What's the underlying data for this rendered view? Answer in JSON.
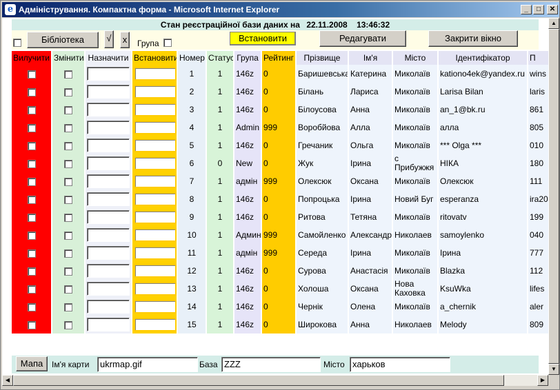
{
  "window": {
    "title": "Адміністрування. Компактна форма - Microsoft Internet Explorer"
  },
  "status": {
    "label": "Стан реєстраційної бази даних на",
    "date": "22.11.2008",
    "time": "13:46:32"
  },
  "toolbar": {
    "library_label": "Бібліотека",
    "check_label": "√",
    "x_label": "x",
    "group_label": "Група",
    "install_label": "Встановити",
    "edit_label": "Редагувати",
    "close_label": "Закрити вікно"
  },
  "table": {
    "headers": {
      "delete": "Вилучити",
      "change": "Змінити",
      "assign": "Назначити",
      "set": "Встановити",
      "number": "Номер",
      "status": "Статус",
      "group": "Група",
      "rating": "Рейтинг",
      "surname": "Прізвище",
      "name": "Ім'я",
      "city": "Місто",
      "id": "Ідентифікатор",
      "extra": "П"
    },
    "rows": [
      {
        "num": "1",
        "status": "1",
        "group": "146z",
        "rating": "0",
        "surname": "Баришевська",
        "name": "Катерина",
        "city": "Миколаїв",
        "id": "kationo4ek@yandex.ru",
        "extra": "wins"
      },
      {
        "num": "2",
        "status": "1",
        "group": "146z",
        "rating": "0",
        "surname": "Білань",
        "name": "Лариса",
        "city": "Миколаїв",
        "id": "Larisa Bilan",
        "extra": "laris"
      },
      {
        "num": "3",
        "status": "1",
        "group": "146z",
        "rating": "0",
        "surname": "Білоусова",
        "name": "Анна",
        "city": "Миколаїв",
        "id": "an_1@bk.ru",
        "extra": "861"
      },
      {
        "num": "4",
        "status": "1",
        "group": "Admin",
        "rating": "999",
        "surname": "Воробйова",
        "name": "Алла",
        "city": "Миколаїв",
        "id": "алла",
        "extra": "805"
      },
      {
        "num": "5",
        "status": "1",
        "group": "146z",
        "rating": "0",
        "surname": "Гречаник",
        "name": "Ольга",
        "city": "Миколаїв",
        "id": "*** Olga ***",
        "extra": "010"
      },
      {
        "num": "6",
        "status": "0",
        "group": "New",
        "rating": "0",
        "surname": "Жук",
        "name": "Ірина",
        "city": "с Прибужжя",
        "id": "НІКА",
        "extra": "180"
      },
      {
        "num": "7",
        "status": "1",
        "group": "адмін",
        "rating": "999",
        "surname": "Олексюк",
        "name": "Оксана",
        "city": "Миколаїв",
        "id": "Олексюк",
        "extra": "111"
      },
      {
        "num": "8",
        "status": "1",
        "group": "146z",
        "rating": "0",
        "surname": "Попроцька",
        "name": "Ірина",
        "city": "Новий Буг",
        "id": "esperanza",
        "extra": "ira20"
      },
      {
        "num": "9",
        "status": "1",
        "group": "146z",
        "rating": "0",
        "surname": "Ритова",
        "name": "Тетяна",
        "city": "Миколаїв",
        "id": "ritovatv",
        "extra": "199"
      },
      {
        "num": "10",
        "status": "1",
        "group": "Админ",
        "rating": "999",
        "surname": "Самойленко",
        "name": "Александр",
        "city": "Николаев",
        "id": "samoylenko",
        "extra": "040"
      },
      {
        "num": "11",
        "status": "1",
        "group": "адмін",
        "rating": "999",
        "surname": "Середа",
        "name": "Ірина",
        "city": "Миколаїв",
        "id": "Ірина",
        "extra": "777"
      },
      {
        "num": "12",
        "status": "1",
        "group": "146z",
        "rating": "0",
        "surname": "Сурова",
        "name": "Анастасія",
        "city": "Миколаїв",
        "id": "Blazka",
        "extra": "112"
      },
      {
        "num": "13",
        "status": "1",
        "group": "146z",
        "rating": "0",
        "surname": "Холоша",
        "name": "Оксана",
        "city": "Нова Каховка",
        "id": "KsuWka",
        "extra": "lifes"
      },
      {
        "num": "14",
        "status": "1",
        "group": "146z",
        "rating": "0",
        "surname": "Чернік",
        "name": "Олена",
        "city": "Миколаїв",
        "id": "a_chernik",
        "extra": "aler"
      },
      {
        "num": "15",
        "status": "1",
        "group": "146z",
        "rating": "0",
        "surname": "Широкова",
        "name": "Анна",
        "city": "Николаев",
        "id": "Melody",
        "extra": "809"
      }
    ]
  },
  "footer": {
    "map_button": "Мапа",
    "map_name_label": "Ім'я карти",
    "map_name_value": "ukrmap.gif",
    "base_label": "База",
    "base_value": "ZZZ",
    "city_label": "Місто",
    "city_value": "харьков"
  },
  "icons": {
    "browser": "ie-logo-icon",
    "minimize": "minimize-icon",
    "maximize": "maximize-icon",
    "close": "close-icon"
  }
}
